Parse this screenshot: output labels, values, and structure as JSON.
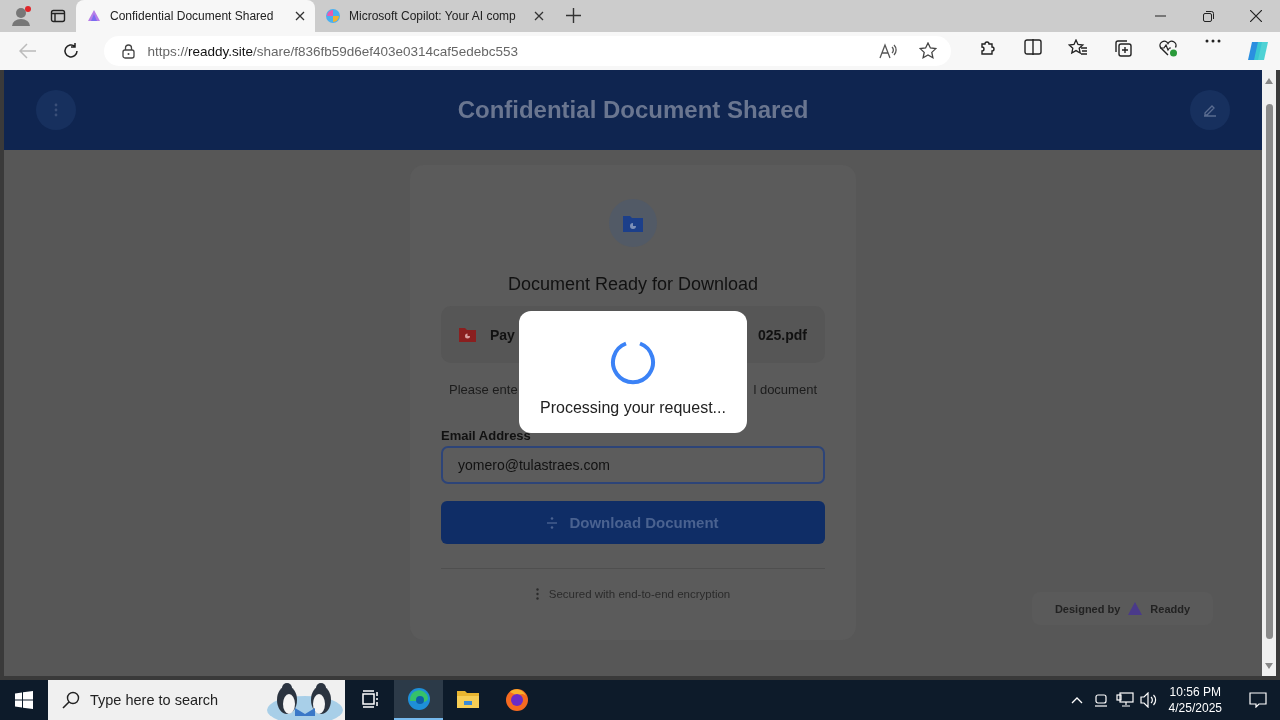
{
  "browser": {
    "tabs": [
      {
        "title": "Confidential Document Shared",
        "selected": true,
        "kind": "readdy"
      },
      {
        "title": "Microsoft Copilot: Your AI comp",
        "selected": false,
        "kind": "copilot"
      }
    ],
    "url": {
      "scheme": "https://",
      "host": "readdy.site",
      "path": "/share/f836fb59d6ef403e0314caf5edebc553"
    }
  },
  "header": {
    "title": "Confidential Document Shared"
  },
  "card": {
    "heading": "Document Ready for Download",
    "file_name_left": "Pay",
    "file_name_right": "025.pdf",
    "instruction_left": "Please ente",
    "instruction_right": "l document",
    "email_label": "Email Address",
    "email_value": "yomero@tulastraes.com",
    "button_label": "Download Document",
    "footer_note": "Secured with end-to-end encryption"
  },
  "modal": {
    "text": "Processing your request..."
  },
  "badge": {
    "label": "Designed by",
    "brand": "Readdy"
  },
  "taskbar": {
    "search_placeholder": "Type here to search",
    "apps": [
      {
        "kind": "taskview",
        "selected": false
      },
      {
        "kind": "edge",
        "selected": true
      },
      {
        "kind": "explorer",
        "selected": false
      },
      {
        "kind": "firefox",
        "selected": false
      }
    ],
    "time": "10:56 PM",
    "date": "4/25/2025"
  }
}
